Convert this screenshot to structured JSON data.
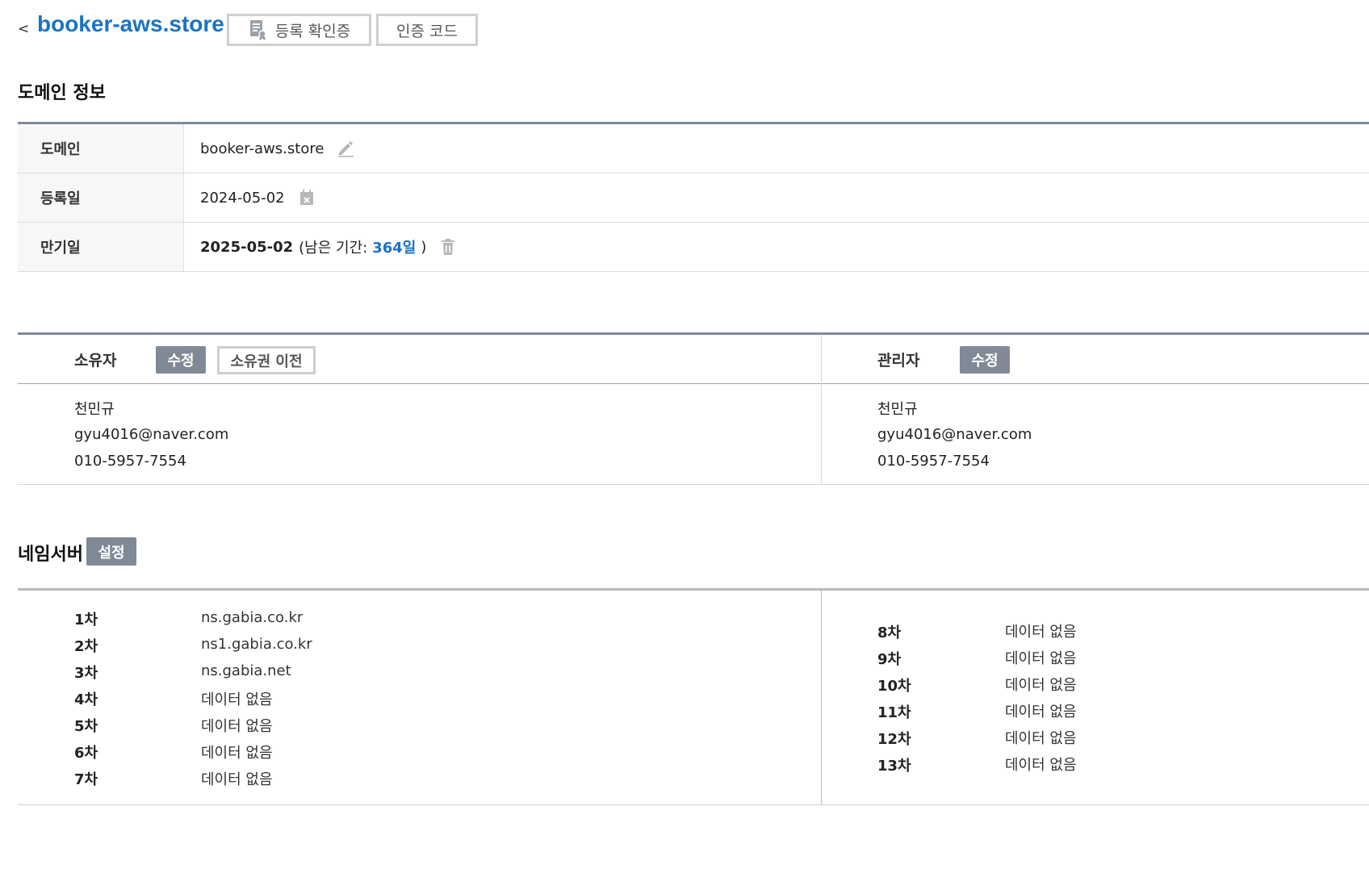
{
  "header": {
    "back_label": "<",
    "domain_title": "booker-aws.store",
    "cert_button": "등록 확인증",
    "auth_code_button": "인증 코드"
  },
  "domain_info": {
    "section_title": "도메인 정보",
    "rows": [
      {
        "label": "도메인",
        "value": "booker-aws.store"
      },
      {
        "label": "등록일",
        "value": "2024-05-02"
      },
      {
        "label": "만기일",
        "value": "2025-05-02",
        "remaining_prefix": "(남은 기간:",
        "remaining_days": "364일",
        "remaining_suffix": ")"
      }
    ]
  },
  "owner": {
    "label": "소유자",
    "edit_button": "수정",
    "transfer_button": "소유권 이전",
    "name": "천민규",
    "email": "gyu4016@naver.com",
    "phone": "010-5957-7554"
  },
  "admin": {
    "label": "관리자",
    "edit_button": "수정",
    "name": "천민규",
    "email": "gyu4016@naver.com",
    "phone": "010-5957-7554"
  },
  "nameservers": {
    "section_title": "네임서버",
    "settings_button": "설정",
    "left": [
      {
        "order": "1차",
        "value": "ns.gabia.co.kr"
      },
      {
        "order": "2차",
        "value": "ns1.gabia.co.kr"
      },
      {
        "order": "3차",
        "value": "ns.gabia.net"
      },
      {
        "order": "4차",
        "value": "데이터 없음"
      },
      {
        "order": "5차",
        "value": "데이터 없음"
      },
      {
        "order": "6차",
        "value": "데이터 없음"
      },
      {
        "order": "7차",
        "value": "데이터 없음"
      }
    ],
    "right": [
      {
        "order": "8차",
        "value": "데이터 없음"
      },
      {
        "order": "9차",
        "value": "데이터 없음"
      },
      {
        "order": "10차",
        "value": "데이터 없음"
      },
      {
        "order": "11차",
        "value": "데이터 없음"
      },
      {
        "order": "12차",
        "value": "데이터 없음"
      },
      {
        "order": "13차",
        "value": "데이터 없음"
      }
    ]
  },
  "colors": {
    "accent": "#1a73c4",
    "button_gray": "#7f8a96",
    "table_border": "#7d8b9b"
  },
  "icons": [
    "certificate-icon",
    "edit-pencil-icon",
    "calendar-x-icon",
    "trash-icon"
  ]
}
